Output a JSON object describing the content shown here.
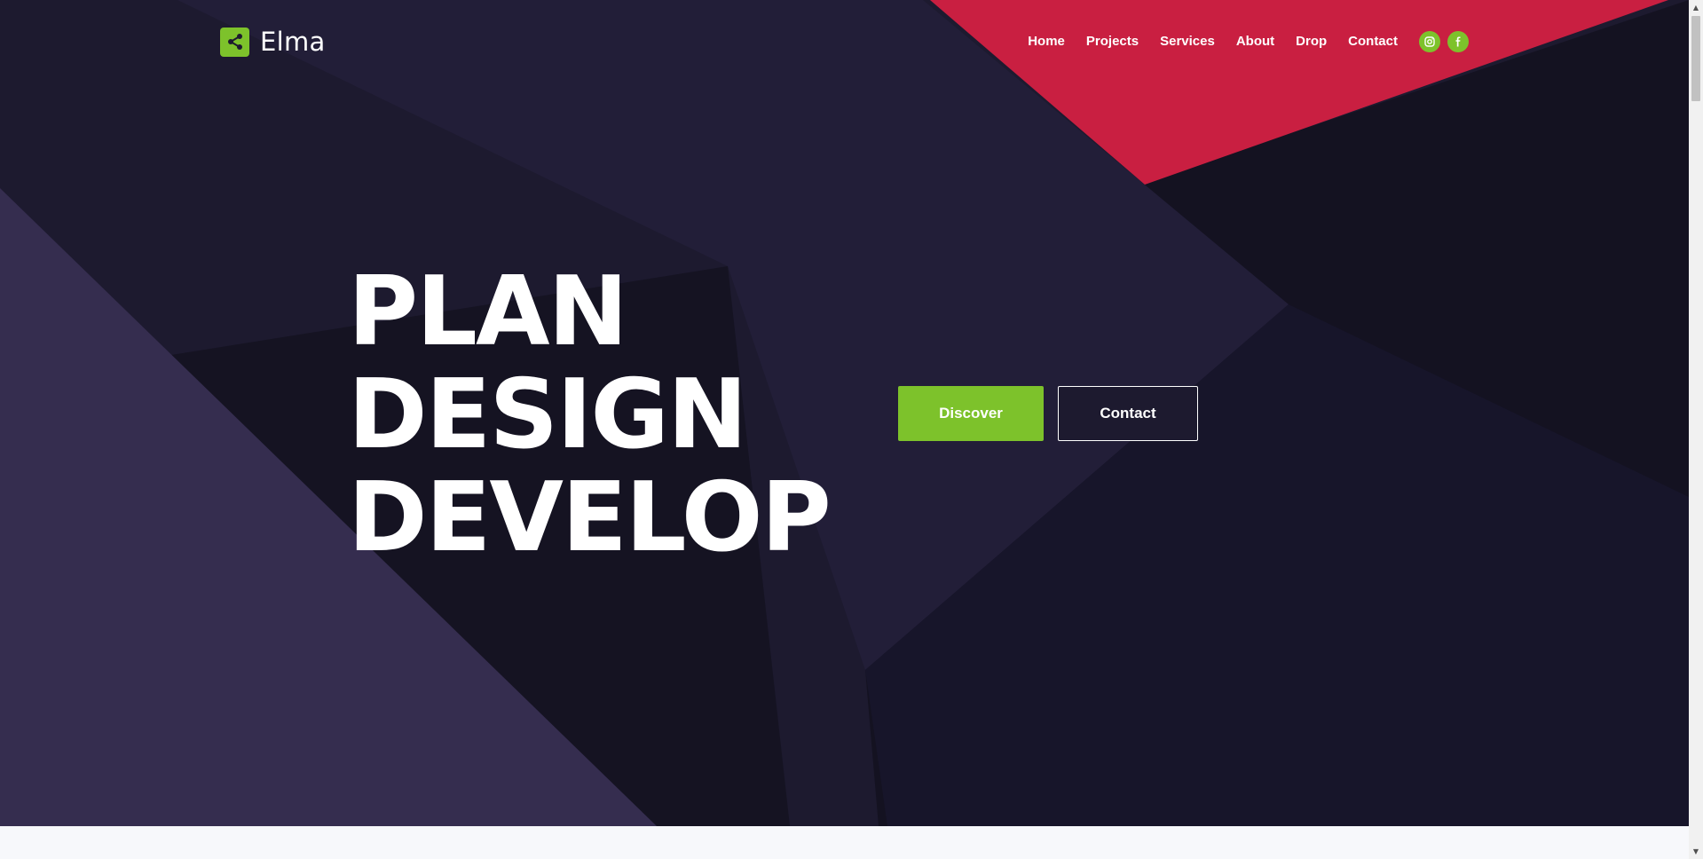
{
  "brand": {
    "name": "Elma",
    "logo_icon": "share-icon",
    "accent_color": "#7dc22b",
    "secondary_color": "#c91f41",
    "background_color": "#1d1a2f"
  },
  "nav": {
    "items": [
      {
        "label": "Home"
      },
      {
        "label": "Projects"
      },
      {
        "label": "Services"
      },
      {
        "label": "About"
      },
      {
        "label": "Drop"
      },
      {
        "label": "Contact"
      }
    ],
    "social": [
      {
        "icon": "instagram-icon"
      },
      {
        "icon": "facebook-icon"
      }
    ]
  },
  "hero": {
    "headline": [
      "PLAN",
      "DESIGN",
      "DEVELOP"
    ],
    "primary_button": "Discover",
    "secondary_button": "Contact"
  }
}
